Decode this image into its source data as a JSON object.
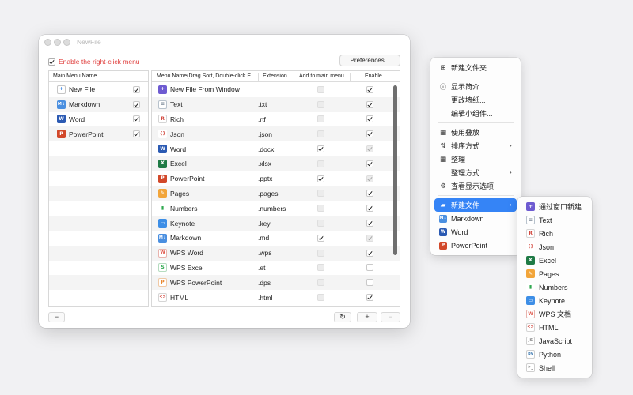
{
  "window": {
    "title": "NewFile",
    "enable_label": "Enable the right-click menu",
    "preferences_label": "Preferences...",
    "left_header": "Main Menu Name",
    "right_headers": {
      "name": "Menu Name(Drag Sort, Double-click E...",
      "ext": "Extension",
      "add": "Add to main menu",
      "enable": "Enable"
    },
    "main_items": [
      {
        "label": "New File",
        "icon": "new-file-icon",
        "checked": true
      },
      {
        "label": "Markdown",
        "icon": "markdown-icon",
        "checked": true
      },
      {
        "label": "Word",
        "icon": "word-icon",
        "checked": true
      },
      {
        "label": "PowerPoint",
        "icon": "powerpoint-icon",
        "checked": true
      }
    ],
    "menu_items": [
      {
        "name": "New File From Window",
        "ext": "",
        "icon": "window-icon",
        "add": false,
        "add_disabled": true,
        "enable": true,
        "enable_disabled": false
      },
      {
        "name": "Text",
        "ext": ".txt",
        "icon": "text-icon",
        "add": false,
        "add_disabled": true,
        "enable": true,
        "enable_disabled": false
      },
      {
        "name": "Rich",
        "ext": ".rtf",
        "icon": "rich-icon",
        "add": false,
        "add_disabled": true,
        "enable": true,
        "enable_disabled": false
      },
      {
        "name": "Json",
        "ext": ".json",
        "icon": "json-icon",
        "add": false,
        "add_disabled": true,
        "enable": true,
        "enable_disabled": false
      },
      {
        "name": "Word",
        "ext": ".docx",
        "icon": "word-icon",
        "add": true,
        "add_disabled": false,
        "enable": true,
        "enable_disabled": true
      },
      {
        "name": "Excel",
        "ext": ".xlsx",
        "icon": "excel-icon",
        "add": false,
        "add_disabled": true,
        "enable": true,
        "enable_disabled": false
      },
      {
        "name": "PowerPoint",
        "ext": ".pptx",
        "icon": "powerpoint-icon",
        "add": true,
        "add_disabled": false,
        "enable": true,
        "enable_disabled": true
      },
      {
        "name": "Pages",
        "ext": ".pages",
        "icon": "pages-icon",
        "add": false,
        "add_disabled": true,
        "enable": true,
        "enable_disabled": false
      },
      {
        "name": "Numbers",
        "ext": ".numbers",
        "icon": "numbers-icon",
        "add": false,
        "add_disabled": true,
        "enable": true,
        "enable_disabled": false
      },
      {
        "name": "Keynote",
        "ext": ".key",
        "icon": "keynote-icon",
        "add": false,
        "add_disabled": true,
        "enable": true,
        "enable_disabled": false
      },
      {
        "name": "Markdown",
        "ext": ".md",
        "icon": "markdown-icon",
        "add": true,
        "add_disabled": false,
        "enable": true,
        "enable_disabled": true
      },
      {
        "name": "WPS Word",
        "ext": ".wps",
        "icon": "wps-word-icon",
        "add": false,
        "add_disabled": true,
        "enable": true,
        "enable_disabled": false
      },
      {
        "name": "WPS Excel",
        "ext": ".et",
        "icon": "wps-excel-icon",
        "add": false,
        "add_disabled": true,
        "enable": false,
        "enable_disabled": false
      },
      {
        "name": "WPS PowerPoint",
        "ext": ".dps",
        "icon": "wps-powerpoint-icon",
        "add": false,
        "add_disabled": true,
        "enable": false,
        "enable_disabled": false
      },
      {
        "name": "HTML",
        "ext": ".html",
        "icon": "html-icon",
        "add": false,
        "add_disabled": true,
        "enable": true,
        "enable_disabled": false
      }
    ],
    "bottom": {
      "minus": "−",
      "refresh": "↻",
      "plus": "+",
      "minus2": "−"
    }
  },
  "context_menu": {
    "items": [
      {
        "label": "新建文件夹",
        "icon": "new-folder-icon",
        "glyph": "⊞"
      },
      {
        "sep": true
      },
      {
        "label": "显示简介",
        "icon": "info-icon",
        "glyph": "ⓘ"
      },
      {
        "label": "更改墙纸...",
        "icon": "",
        "glyph": ""
      },
      {
        "label": "编辑小组件...",
        "icon": "",
        "glyph": ""
      },
      {
        "sep": true
      },
      {
        "label": "使用叠放",
        "icon": "stack-icon",
        "glyph": "▦"
      },
      {
        "label": "排序方式",
        "icon": "sort-icon",
        "glyph": "⇅",
        "submenu": true
      },
      {
        "label": "整理",
        "icon": "grid-icon",
        "glyph": "▦"
      },
      {
        "label": "整理方式",
        "icon": "",
        "glyph": "",
        "submenu": true
      },
      {
        "label": "查看显示选项",
        "icon": "view-options-icon",
        "glyph": "⚙"
      },
      {
        "sep": true
      },
      {
        "label": "新建文件",
        "icon": "new-file-icon",
        "glyph": "▰",
        "submenu": true,
        "active": true
      },
      {
        "label": "Markdown",
        "icon": "markdown-icon",
        "glyph": "M"
      },
      {
        "label": "Word",
        "icon": "word-icon",
        "glyph": "W"
      },
      {
        "label": "PowerPoint",
        "icon": "powerpoint-icon",
        "glyph": "P"
      }
    ]
  },
  "submenu": {
    "items": [
      {
        "label": "通过窗口新建",
        "icon": "window-icon"
      },
      {
        "label": "Text",
        "icon": "text-icon"
      },
      {
        "label": "Rich",
        "icon": "rich-icon"
      },
      {
        "label": "Json",
        "icon": "json-icon"
      },
      {
        "label": "Excel",
        "icon": "excel-icon"
      },
      {
        "label": "Pages",
        "icon": "pages-icon"
      },
      {
        "label": "Numbers",
        "icon": "numbers-icon"
      },
      {
        "label": "Keynote",
        "icon": "keynote-icon"
      },
      {
        "label": "WPS 文档",
        "icon": "wps-word-icon"
      },
      {
        "label": "HTML",
        "icon": "html-icon"
      },
      {
        "label": "JavaScript",
        "icon": "javascript-icon"
      },
      {
        "label": "Python",
        "icon": "python-icon"
      },
      {
        "label": "Shell",
        "icon": "shell-icon"
      }
    ]
  },
  "icon_styles": {
    "new-file-icon": {
      "bg": "#ffffff",
      "fg": "#2f7de1",
      "glyph": "+",
      "border": "#c6c6c6"
    },
    "window-icon": {
      "bg": "#6e5bd1",
      "fg": "#ffffff",
      "glyph": "+"
    },
    "markdown-icon": {
      "bg": "#4a8fe0",
      "fg": "#ffffff",
      "glyph": "M↓"
    },
    "word-icon": {
      "bg": "#2b5ab3",
      "fg": "#ffffff",
      "glyph": "W"
    },
    "powerpoint-icon": {
      "bg": "#d2482a",
      "fg": "#ffffff",
      "glyph": "P"
    },
    "excel-icon": {
      "bg": "#1f7a45",
      "fg": "#ffffff",
      "glyph": "X"
    },
    "text-icon": {
      "bg": "#ffffff",
      "fg": "#7a8796",
      "glyph": "≡",
      "border": "#b8c2cc"
    },
    "rich-icon": {
      "bg": "#ffffff",
      "fg": "#d1443a",
      "glyph": "R",
      "border": "#d5d5d5"
    },
    "json-icon": {
      "bg": "#ffffff",
      "fg": "#d1443a",
      "glyph": "{}",
      "border": "#ffffff"
    },
    "pages-icon": {
      "bg": "#f2a53a",
      "fg": "#ffffff",
      "glyph": "✎"
    },
    "numbers-icon": {
      "bg": "#ffffff",
      "fg": "#2fa84f",
      "glyph": "▮",
      "border": "#ffffff"
    },
    "keynote-icon": {
      "bg": "#3d8ee6",
      "fg": "#ffffff",
      "glyph": "▭"
    },
    "wps-word-icon": {
      "bg": "#ffffff",
      "fg": "#e05a4e",
      "glyph": "W",
      "border": "#e8b4ae"
    },
    "wps-excel-icon": {
      "bg": "#ffffff",
      "fg": "#2fa84f",
      "glyph": "S",
      "border": "#b5dcbf"
    },
    "wps-powerpoint-icon": {
      "bg": "#ffffff",
      "fg": "#e8842a",
      "glyph": "P",
      "border": "#f0c9a5"
    },
    "html-icon": {
      "bg": "#ffffff",
      "fg": "#d1443a",
      "glyph": "<>",
      "border": "#d5d5d5"
    },
    "javascript-icon": {
      "bg": "#ffffff",
      "fg": "#8a8a8a",
      "glyph": "JS",
      "border": "#cfcfcf"
    },
    "python-icon": {
      "bg": "#ffffff",
      "fg": "#3b78b0",
      "glyph": "py",
      "border": "#cfcfcf"
    },
    "shell-icon": {
      "bg": "#ffffff",
      "fg": "#555555",
      "glyph": ">_",
      "border": "#cfcfcf"
    }
  }
}
